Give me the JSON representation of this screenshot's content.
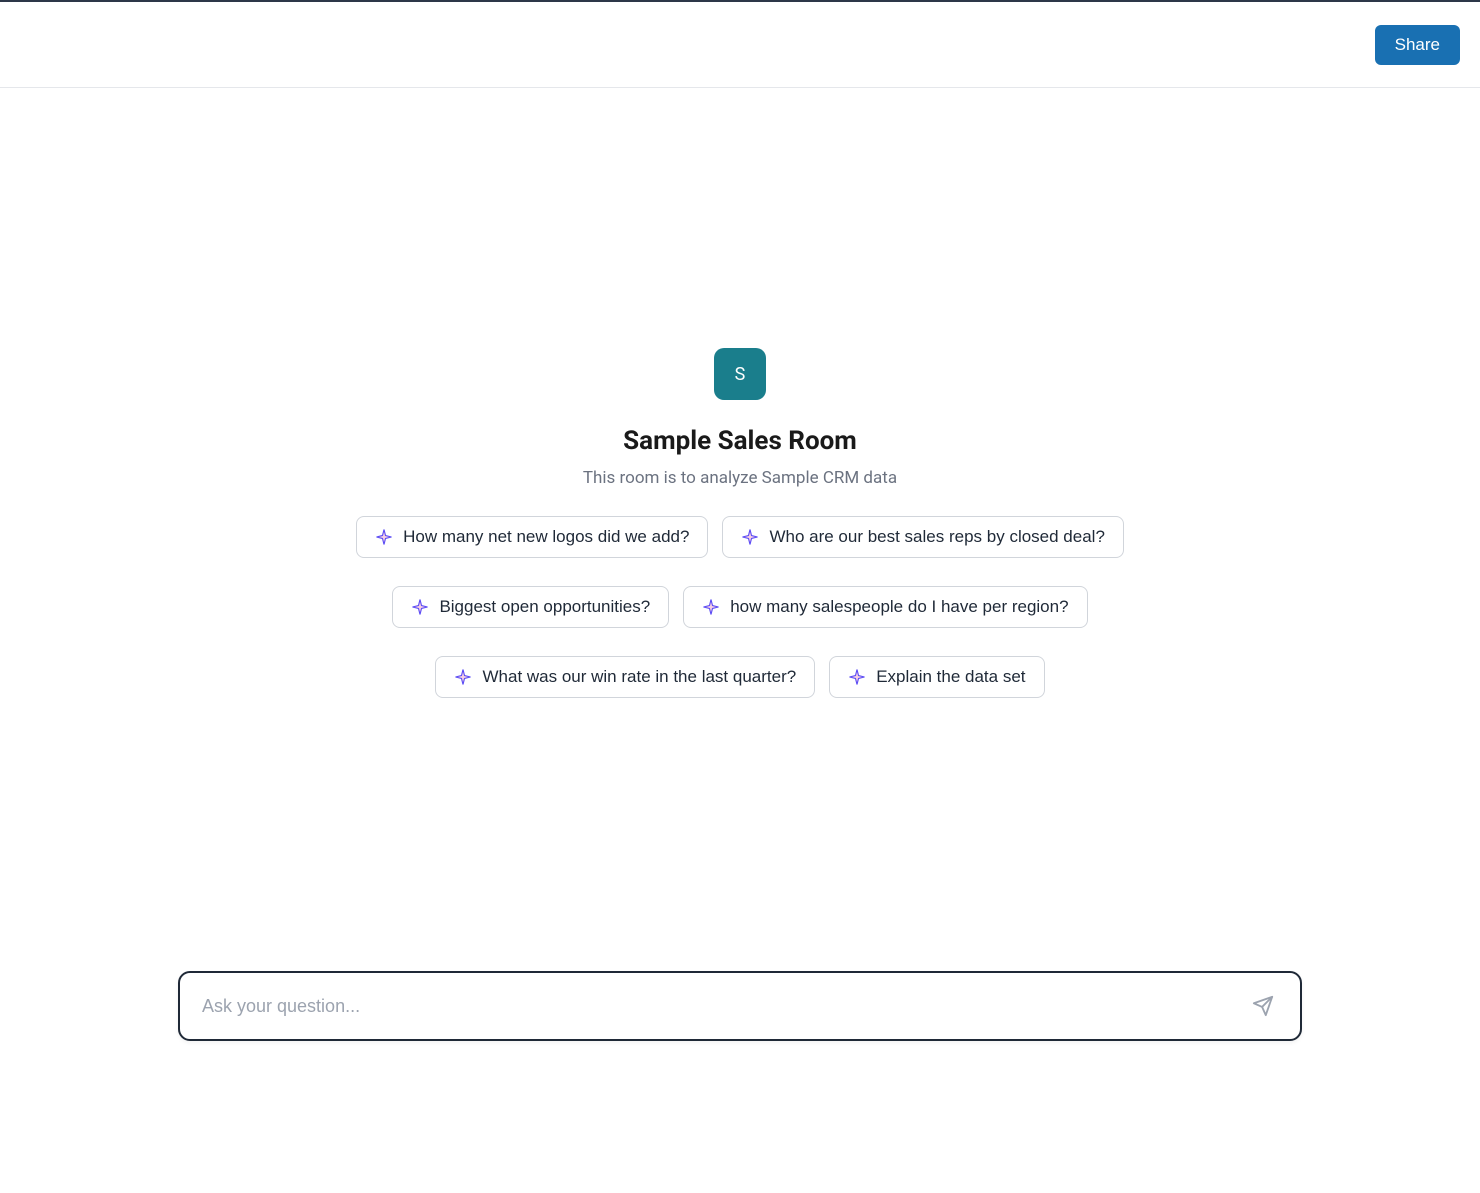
{
  "header": {
    "share_label": "Share"
  },
  "room": {
    "avatar_letter": "S",
    "title": "Sample Sales Room",
    "description": "This room is to analyze Sample CRM data"
  },
  "suggestions": [
    "How many net new logos did we add?",
    "Who are our best sales reps by closed deal?",
    "Biggest open opportunities?",
    "how many salespeople do I have per region?",
    "What was our win rate in the last quarter?",
    "Explain the data set"
  ],
  "input": {
    "placeholder": "Ask your question...",
    "value": ""
  },
  "colors": {
    "primary": "#1970b2",
    "avatar": "#1a7e8c",
    "sparkle_outer": "#5b4cf5",
    "sparkle_inner": "#e94b8c"
  }
}
